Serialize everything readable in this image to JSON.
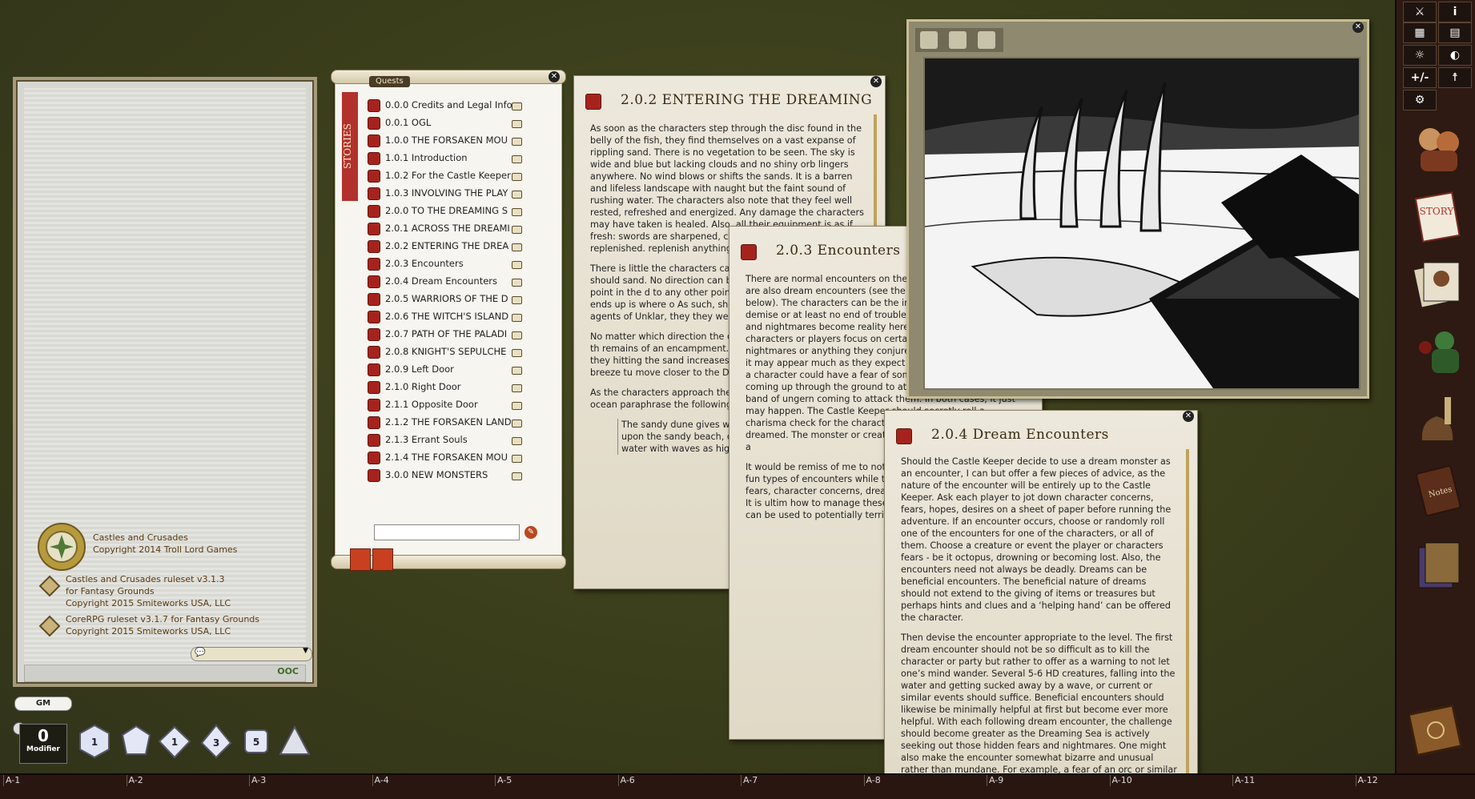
{
  "chat": {
    "messages": [
      {
        "line1": "Castles and Crusades",
        "line2": "Copyright 2014 Troll Lord Games"
      },
      {
        "line1": "Castles and Crusades ruleset v3.1.3",
        "line2": "for Fantasy Grounds",
        "line3": "Copyright 2015 Smiteworks USA, LLC"
      },
      {
        "line1": "CoreRPG ruleset v3.1.7 for Fantasy Grounds",
        "line2": "Copyright 2015 Smiteworks USA, LLC"
      }
    ],
    "ooc_label": "OOC"
  },
  "gm_badge": "GM",
  "modifier": {
    "value": "0",
    "label": "Modifier"
  },
  "dice": [
    "d20",
    "d12",
    "d10",
    "d8",
    "d6",
    "d4"
  ],
  "die_faces": {
    "d20": "1",
    "d12": "",
    "d10": "1",
    "d8": "3",
    "d6": "5",
    "d4": ""
  },
  "quests": {
    "tab_label": "Quests",
    "side_label": "STORIES",
    "items": [
      "0.0.0 Credits and Legal Info",
      "0.0.1 OGL",
      "1.0.0 THE FORSAKEN MOU",
      "1.0.1 Introduction",
      "1.0.2 For the Castle Keeper",
      "1.0.3 INVOLVING THE PLAY",
      "2.0.0 TO THE DREAMING S",
      "2.0.1 ACROSS THE DREAMI",
      "2.0.2 ENTERING THE DREA",
      "2.0.3 Encounters",
      "2.0.4 Dream Encounters",
      "2.0.5 WARRIORS OF THE D",
      "2.0.6 THE WITCH'S ISLAND",
      "2.0.7 PATH OF THE PALADI",
      "2.0.8 KNIGHT'S SEPULCHE",
      "2.0.9 Left Door",
      "2.1.0 Right Door",
      "2.1.1 Opposite Door",
      "2.1.2 THE FORSAKEN LAND",
      "2.1.3 Errant Souls",
      "2.1.4 THE FORSAKEN MOU",
      "3.0.0 NEW MONSTERS"
    ]
  },
  "story1": {
    "title": "2.0.2 ENTERING THE DREAMING",
    "p1": "As soon as the characters step through the disc found in the belly of the fish, they find themselves on a vast expanse of rippling sand. There is no vegetation to be seen. The sky is wide and blue but lacking clouds and no shiny orb lingers anywhere. No wind blows or shifts the sands. It is a barren and lifeless landscape with naught but the faint sound of rushing water. The characters also note that they feel well rested, refreshed and energized. Any damage the characters may have taken is healed. Also, all their equipment is as if fresh: swords are sharpened, clothes clean, food and water replenished. replenish anything used or lost.",
    "p2": "There is little the characters can walk - which is what they should sand. No direction can be deter means. No single point in the d to any other point making direc Where one ends up is where o As such, should the characters find the agents of Unklar, they they were.",
    "p3": "No matter which direction the on the edge of the waters of th remains of an encampment. Th several hours or more. As they hitting the sand increases in vo begins picks up. This breeze tu move closer to the Dreaming S",
    "p4": "As the characters approach the see a limitless expanse of ocean paraphrase the following:",
    "quote": "The sandy dune gives wa green water; an ocean, b upon the sandy beach, dr or some other unseen fo water with waves as high"
  },
  "story2": {
    "title": "2.0.3 Encounters",
    "p1": "There are normal encounters on the Dreaming Sea but there are also dream encounters (see the encounter section below). The characters can be the instrument of their own demise or at least no end of trouble for themselves. Dreams and nightmares become reality here. Should any of the characters or players focus on certain fears, dreams, nightmares or anything they conjure out of their imagination, it may appear much as they expect or desire it. For example, a character could have a fear of some voracious sand worm coming up through the ground to attack the party or of a band of ungern coming to attack them. In both cases, it just may happen. The Castle Keeper should secretly roll a charisma check for the character at CL 8. Should the ch dreamed. The monster or creat character may be thinking of a",
    "p2": "It would be remiss of me to not Keeper can have no end of fun types of encounters while the p Dreaming Sea. Thoughts, fears, character concerns, dreams and while traveling here. It is ultim how to manage these. They can ignored, or they can be used to potentially terrifying encounter"
  },
  "story3": {
    "title": "2.0.4 Dream Encounters",
    "p1": "Should the Castle Keeper decide to use a dream monster as an encounter, I can but offer a few pieces of advice, as the nature of the encounter will be entirely up to the Castle Keeper. Ask each player to jot down character concerns, fears, hopes, desires on a sheet of paper before running the adventure. If an encounter occurs, choose or randomly roll one of the encounters for one of the characters, or all of them. Choose a creature or event the player or characters fears - be it octopus, drowning or becoming lost. Also, the encounters need not always be deadly. Dreams can be beneficial encounters. The beneficial nature of dreams should not extend to the giving of items or treasures but perhaps hints and clues and a ‘helping hand’ can be offered the character.",
    "p2": "Then devise the encounter appropriate to the level. The first dream encounter should not be so difficult as to kill the character or party but rather to offer as a warning to not let one’s mind wander. Several 5-6 HD creatures, falling into the water and getting sucked away by a wave, or current or similar events should suffice. Beneficial encounters should likewise be minimally helpful at first but become ever more helpful. With each following dream encounter, the challenge should become greater as the Dreaming Sea is actively seeking out those hidden fears and nightmares. One might also make the encounter somewhat bizarre and unusual rather than mundane. For example, a fear of an orc or similar creature may not be a regular orc but a giant orc with the equivalent HD and damage of a hill giant."
  },
  "sidebar": {
    "buttons": [
      "⚔",
      "i",
      "▦",
      "▤",
      "☼",
      "◐",
      "+/-",
      "☨",
      "⚙"
    ],
    "story_label": "STORY",
    "notes_label": "Notes"
  },
  "hotkeys": [
    "A-1",
    "A-2",
    "A-3",
    "A-4",
    "A-5",
    "A-6",
    "A-7",
    "A-8",
    "A-9",
    "A-10",
    "A-11",
    "A-12"
  ],
  "colors": {
    "desk": "#3a3d1a",
    "story_red": "#a6231d",
    "parchment": "#e8e2d2"
  }
}
